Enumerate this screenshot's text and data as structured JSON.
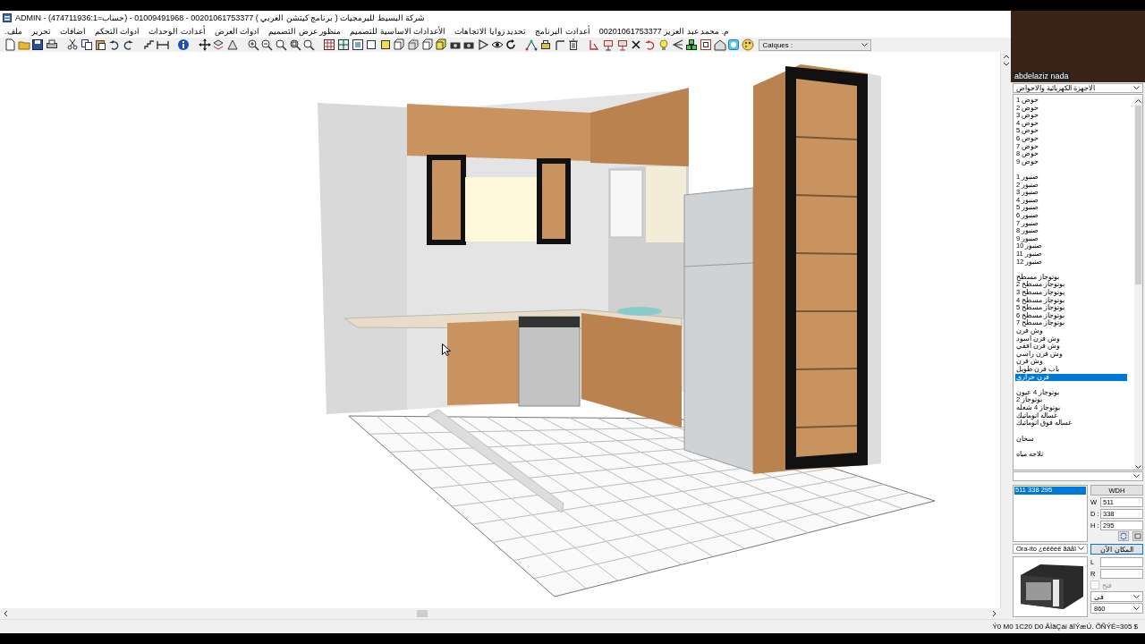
{
  "window": {
    "title": "ADMIN - شركة البسيط للبرمجيات ( برنامج كيتشن العربي ) 00201061753377 - 01009491968 - (حساب=474711936:1)"
  },
  "menu": [
    "م. محمد عبد العزيز 00201061753377",
    "أعدادت البرنامج",
    "تحديد زوايا الاتجاهات",
    "الأعدادات الاساسية للتصميم",
    "منظور عرض التصميم",
    "ادوات العرض",
    "أعدادت الوحدات",
    "ادوات التحكم",
    "اضافات",
    "تحرير",
    "ملف."
  ],
  "toolbar": {
    "layers_combo": {
      "value": "Calques :"
    }
  },
  "video_overlay": {
    "caption": "abdelaziz nada"
  },
  "side_panel": {
    "category": {
      "value": "الاجهزة الكهربائية والاحواض"
    },
    "groups": [
      {
        "items": [
          {
            "label": "حوض 1",
            "selected": false
          },
          {
            "label": "حوض 2",
            "selected": false
          },
          {
            "label": "حوض 3",
            "selected": false
          },
          {
            "label": "حوض 4",
            "selected": false
          },
          {
            "label": "حوض 5",
            "selected": false
          },
          {
            "label": "حوض 6",
            "selected": false
          },
          {
            "label": "حوض 7",
            "selected": false
          },
          {
            "label": "حوض 8",
            "selected": false
          },
          {
            "label": "حوض 9",
            "selected": false
          }
        ]
      },
      {
        "items": [
          {
            "label": "صنبور 1",
            "selected": false
          },
          {
            "label": "صنبور 2",
            "selected": false
          },
          {
            "label": "صنبور 3",
            "selected": false
          },
          {
            "label": "صنبور 4",
            "selected": false
          },
          {
            "label": "صنبور 5",
            "selected": false
          },
          {
            "label": "صنبور 6",
            "selected": false
          },
          {
            "label": "صنبور 7",
            "selected": false
          },
          {
            "label": "صنبور 8",
            "selected": false
          },
          {
            "label": "صنبور 9",
            "selected": false
          },
          {
            "label": "صنبور 10",
            "selected": false
          },
          {
            "label": "صنبور 11",
            "selected": false
          },
          {
            "label": "صنبور 12",
            "selected": false
          }
        ]
      },
      {
        "items": [
          {
            "label": "بوتوجاز مسطح",
            "selected": false
          },
          {
            "label": "بوتوجاز مسطح 2",
            "selected": false
          },
          {
            "label": "بوتوجاز مسطح 3",
            "selected": false
          },
          {
            "label": "بوتوجاز مسطح 4",
            "selected": false
          },
          {
            "label": "بوتوجاز مسطح 5",
            "selected": false
          },
          {
            "label": "بوتوجاز مسطح 6",
            "selected": false
          },
          {
            "label": "بوتوجاز مسطح 7",
            "selected": false
          },
          {
            "label": "وش فرن",
            "selected": false
          },
          {
            "label": "وش فرن اسود",
            "selected": false
          },
          {
            "label": "وش فرن افقي",
            "selected": false
          },
          {
            "label": "وش فرن راسي",
            "selected": false
          },
          {
            "label": "وش فرن",
            "selected": false
          },
          {
            "label": "باب فرن طويل",
            "selected": false
          },
          {
            "label": "فرن حراري",
            "selected": true
          }
        ]
      },
      {
        "items": [
          {
            "label": "بوتوجاز 4 عيون",
            "selected": false
          },
          {
            "label": "بوتوجاز 2",
            "selected": false
          },
          {
            "label": "بوتوجاز 4 شعله",
            "selected": false
          },
          {
            "label": "غساله اتوماتيك",
            "selected": false
          },
          {
            "label": "غساله فوق اتوماتيك",
            "selected": false
          }
        ]
      },
      {
        "items": [
          {
            "label": "سخان",
            "selected": false
          }
        ]
      },
      {
        "items": [
          {
            "label": "ثلاجه مياه",
            "selected": false
          }
        ]
      }
    ],
    "dimensions": {
      "list": [
        {
          "label": "511  338  295",
          "selected": true
        }
      ],
      "mode_button": "WDH",
      "fields": [
        {
          "label": "W",
          "value": "511"
        },
        {
          "label": "D :",
          "value": "338"
        },
        {
          "label": "H :",
          "value": "295"
        }
      ]
    },
    "material_combo": {
      "value": "Ora-ito ¿éêëèê ãäåï"
    },
    "place_button": "المكان الآن",
    "side_fields": [
      {
        "label": "L"
      },
      {
        "label": "R"
      }
    ],
    "option_checkbox": {
      "label": "فتح",
      "checked": false,
      "disabled": true
    },
    "combos": [
      {
        "value": "فى"
      },
      {
        "value": "860"
      }
    ]
  },
  "status_bar": {
    "text": "Ý0 M0  1C20 D0  ÂÌãÇáí ãÏÝæÚ. ÕÑÝÉ=305 $"
  }
}
